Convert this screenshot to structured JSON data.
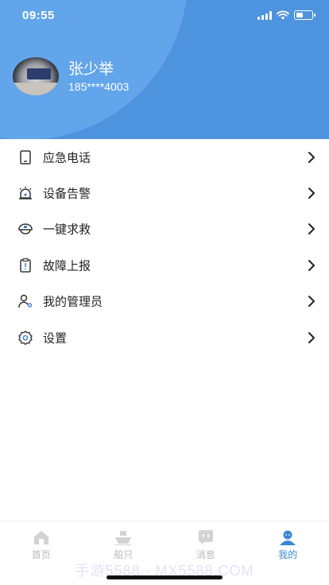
{
  "status_bar": {
    "time": "09:55"
  },
  "profile": {
    "name": "张少举",
    "phone": "185****4003"
  },
  "menu": {
    "items": [
      {
        "label": "应急电话",
        "icon": "phone-icon"
      },
      {
        "label": "设备告警",
        "icon": "alarm-icon"
      },
      {
        "label": "一键求救",
        "icon": "rescue-icon"
      },
      {
        "label": "故障上报",
        "icon": "report-icon"
      },
      {
        "label": "我的管理员",
        "icon": "admin-icon"
      },
      {
        "label": "设置",
        "icon": "settings-icon"
      }
    ]
  },
  "tabbar": {
    "tabs": [
      {
        "label": "首页",
        "icon": "home-icon",
        "active": false
      },
      {
        "label": "船只",
        "icon": "ship-icon",
        "active": false
      },
      {
        "label": "消息",
        "icon": "message-icon",
        "active": false
      },
      {
        "label": "我的",
        "icon": "user-icon",
        "active": true
      }
    ]
  },
  "watermark": "手游5588 · MX5588.COM",
  "colors": {
    "header": "#4e93dd",
    "header_circle": "#62a5ea",
    "tab_active": "#3b86d6",
    "tab_inactive": "#b9b9b9"
  }
}
